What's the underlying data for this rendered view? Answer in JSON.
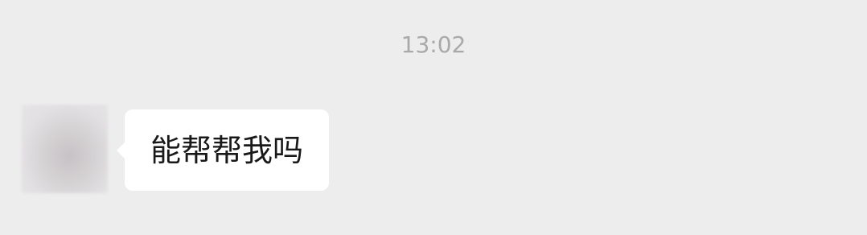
{
  "chat": {
    "timestamp": "13:02",
    "messages": [
      {
        "sender": "other",
        "avatar_icon": "user-avatar-blurred",
        "text": "能帮帮我吗"
      }
    ]
  },
  "colors": {
    "background": "#ededed",
    "bubble_incoming": "#ffffff",
    "timestamp_text": "#a9a9a9",
    "message_text": "#191919"
  }
}
